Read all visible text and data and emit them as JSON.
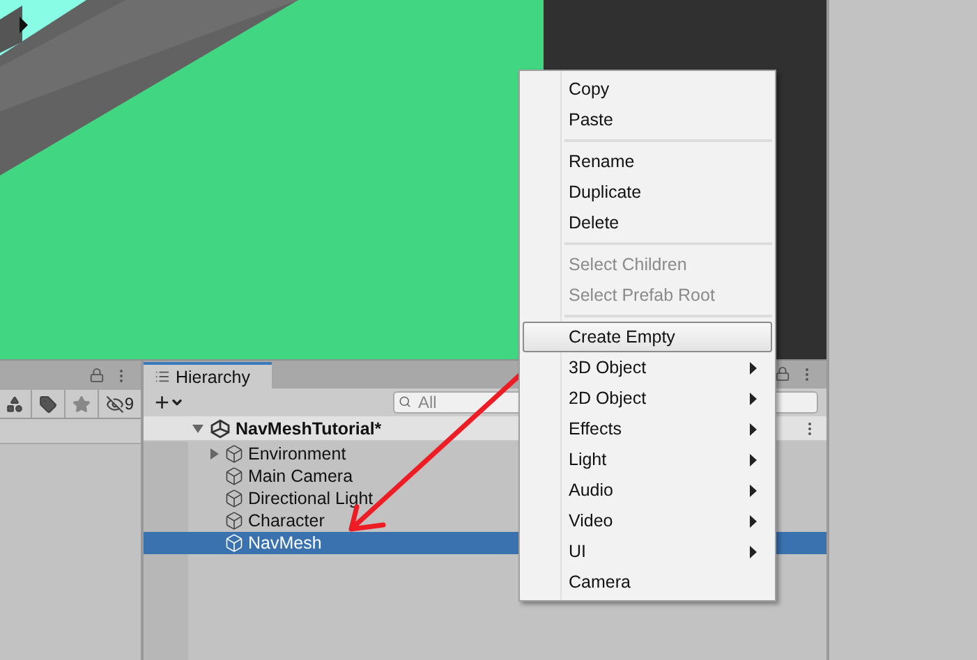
{
  "project_panel": {
    "hidden_count": "9"
  },
  "hierarchy": {
    "tab": {
      "label": "Hierarchy",
      "selected": true
    },
    "add_button": "+",
    "search": {
      "placeholder": "All"
    },
    "scene": {
      "name": "NavMeshTutorial*",
      "expanded": true,
      "children": [
        {
          "name": "Environment",
          "expandable": true,
          "selected": false
        },
        {
          "name": "Main Camera",
          "expandable": false,
          "selected": false
        },
        {
          "name": "Directional Light",
          "expandable": false,
          "selected": false
        },
        {
          "name": "Character",
          "expandable": false,
          "selected": false
        },
        {
          "name": "NavMesh",
          "expandable": false,
          "selected": true
        }
      ]
    }
  },
  "context_menu": {
    "items": [
      {
        "kind": "item",
        "label": "Copy",
        "disabled": false,
        "selected": false,
        "submenu": false
      },
      {
        "kind": "item",
        "label": "Paste",
        "disabled": false,
        "selected": false,
        "submenu": false
      },
      {
        "kind": "separator"
      },
      {
        "kind": "item",
        "label": "Rename",
        "disabled": false,
        "selected": false,
        "submenu": false
      },
      {
        "kind": "item",
        "label": "Duplicate",
        "disabled": false,
        "selected": false,
        "submenu": false
      },
      {
        "kind": "item",
        "label": "Delete",
        "disabled": false,
        "selected": false,
        "submenu": false
      },
      {
        "kind": "separator"
      },
      {
        "kind": "item",
        "label": "Select Children",
        "disabled": true,
        "selected": false,
        "submenu": false
      },
      {
        "kind": "item",
        "label": "Select Prefab Root",
        "disabled": true,
        "selected": false,
        "submenu": false
      },
      {
        "kind": "separator"
      },
      {
        "kind": "item",
        "label": "Create Empty",
        "disabled": false,
        "selected": true,
        "submenu": false
      },
      {
        "kind": "item",
        "label": "3D Object",
        "disabled": false,
        "selected": false,
        "submenu": true
      },
      {
        "kind": "item",
        "label": "2D Object",
        "disabled": false,
        "selected": false,
        "submenu": true
      },
      {
        "kind": "item",
        "label": "Effects",
        "disabled": false,
        "selected": false,
        "submenu": true
      },
      {
        "kind": "item",
        "label": "Light",
        "disabled": false,
        "selected": false,
        "submenu": true
      },
      {
        "kind": "item",
        "label": "Audio",
        "disabled": false,
        "selected": false,
        "submenu": true
      },
      {
        "kind": "item",
        "label": "Video",
        "disabled": false,
        "selected": false,
        "submenu": true
      },
      {
        "kind": "item",
        "label": "UI",
        "disabled": false,
        "selected": false,
        "submenu": true
      },
      {
        "kind": "item",
        "label": "Camera",
        "disabled": false,
        "selected": false,
        "submenu": false
      }
    ]
  }
}
